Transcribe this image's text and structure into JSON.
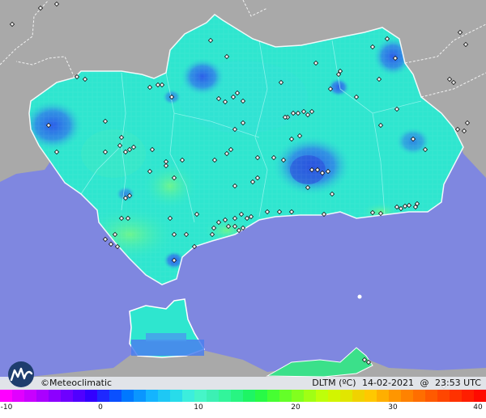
{
  "brand": {
    "copyright": "©",
    "name": "Meteoclimatic"
  },
  "meta": {
    "variable": "DLTM (ºC)",
    "date": "14-02-2021",
    "at": "@",
    "time": "23:53 UTC"
  },
  "legend": {
    "ticks": [
      "-10",
      "0",
      "10",
      "20",
      "30",
      "40"
    ],
    "colors": [
      "#ff00ff",
      "#e100ff",
      "#c800ff",
      "#aa00ff",
      "#8c00ff",
      "#6e00ff",
      "#5000ff",
      "#3200ff",
      "#1e28ff",
      "#0a50ff",
      "#0078ff",
      "#0a96ff",
      "#14b4ff",
      "#1ec8f5",
      "#28dcea",
      "#3ceedd",
      "#46f5c8",
      "#3cf0b4",
      "#32f59b",
      "#28f582",
      "#1ef564",
      "#28fa46",
      "#46ff32",
      "#64ff28",
      "#82ff1e",
      "#a0ff14",
      "#beff0a",
      "#d2f500",
      "#e1e600",
      "#f0d200",
      "#ffc800",
      "#ffaf00",
      "#ff9600",
      "#ff8200",
      "#ff6e00",
      "#ff5a00",
      "#ff4600",
      "#ff3200",
      "#ff1e00",
      "#ff0a00"
    ]
  },
  "colors": {
    "sea": "#7f87e0",
    "land": "#a9a9a9",
    "region_base": "#2ee6cf",
    "warm_zone": "#5ef2a0",
    "cold_spot": "#2f6be8",
    "morocco_zone": "#3be08a"
  },
  "stations_label": "weather-station markers"
}
